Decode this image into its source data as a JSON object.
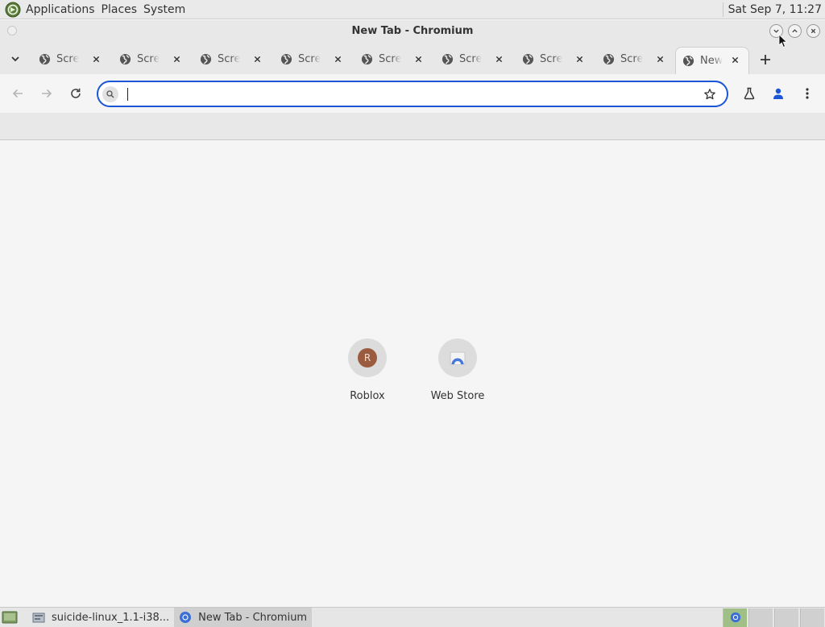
{
  "top_panel": {
    "menus": [
      "Applications",
      "Places",
      "System"
    ],
    "clock": "Sat Sep  7, 11:27"
  },
  "window": {
    "title": "New Tab - Chromium"
  },
  "tabs": [
    {
      "title": "Screenshot",
      "active": false
    },
    {
      "title": "Screenshot",
      "active": false
    },
    {
      "title": "Screenshot",
      "active": false
    },
    {
      "title": "Screenshot",
      "active": false
    },
    {
      "title": "Screenshot",
      "active": false
    },
    {
      "title": "Screenshot",
      "active": false
    },
    {
      "title": "Screenshot",
      "active": false
    },
    {
      "title": "Screenshot",
      "active": false
    },
    {
      "title": "New Tab",
      "active": true
    }
  ],
  "omnibox": {
    "value": "",
    "placeholder": ""
  },
  "shortcuts": [
    {
      "label": "Roblox",
      "badge": "R",
      "icon": "roblox-letter-icon"
    },
    {
      "label": "Web Store",
      "icon": "web-store-icon"
    }
  ],
  "taskbar": {
    "items": [
      {
        "label": "suicide-linux_1.1-i38...",
        "icon": "package-icon",
        "active": false
      },
      {
        "label": "New Tab - Chromium",
        "icon": "chromium-icon",
        "active": true
      }
    ]
  },
  "colors": {
    "accent": "#1a56d6",
    "page_bg": "#f5f5f5",
    "chrome_bg": "#e8e8e8"
  }
}
